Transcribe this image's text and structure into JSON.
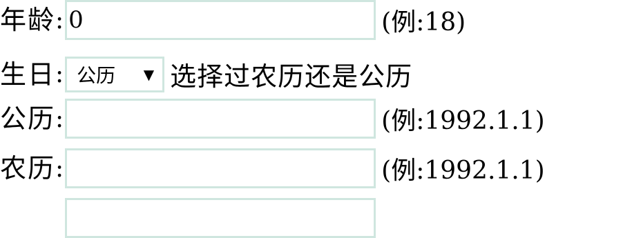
{
  "form": {
    "age": {
      "label": "年龄",
      "colon": ":",
      "value": "0",
      "hint": "(例:18)"
    },
    "birthday": {
      "label": "生日",
      "colon": ":",
      "select_value": "公历",
      "select_arrow": "▼",
      "note": "选择过农历还是公历"
    },
    "solar": {
      "label": "公历",
      "colon": ":",
      "value": "",
      "hint": "(例:1992.1.1)"
    },
    "lunar": {
      "label": "农历",
      "colon": ":",
      "value": "",
      "hint": "(例:1992.1.1)"
    }
  },
  "colors": {
    "field_border": "#cfe6df",
    "text": "#000000",
    "background": "#ffffff"
  }
}
